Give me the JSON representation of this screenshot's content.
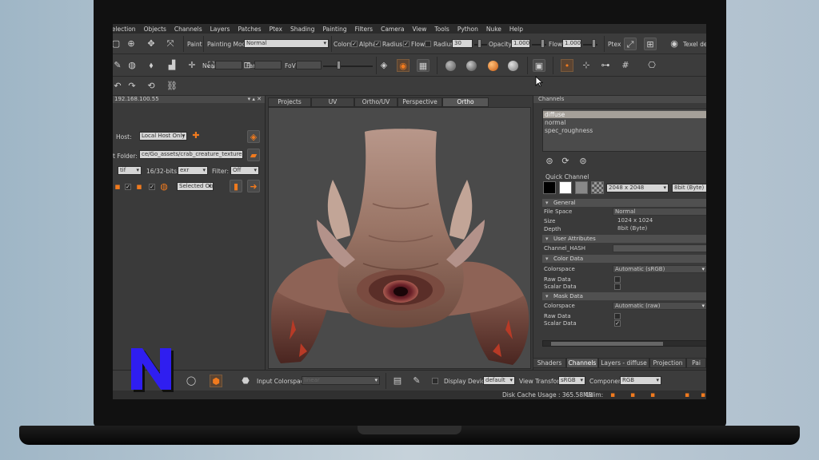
{
  "menu": [
    "Selection",
    "Objects",
    "Channels",
    "Layers",
    "Patches",
    "Ptex",
    "Shading",
    "Painting",
    "Filters",
    "Camera",
    "View",
    "Tools",
    "Python",
    "Nuke",
    "Help"
  ],
  "toolbar1": {
    "paint_label": "Paint",
    "painting_mode_label": "Painting Mode",
    "painting_mode_value": "Normal",
    "colors_label": "Colors",
    "alpha_label": "Alpha",
    "radius_check_label": "Radius",
    "flow_check_label": "Flow",
    "radius_label": "Radius",
    "radius_value": "30",
    "opacity_label": "Opacity",
    "opacity_value": "1.000",
    "flow_label": "Flow",
    "flow_value": "1.000",
    "ptex_label": "Ptex",
    "texel_label": "Texel de"
  },
  "toolbar2": {
    "near_label": "Near",
    "far_label": "Far",
    "fov_label": "FoV"
  },
  "left_panel": {
    "header_text": "192.168.100.55",
    "host_label": "Host:",
    "host_value": "Local Host Only",
    "folder_label": "t Folder:",
    "folder_value": "ce/Go_assets/crab_creature_textured",
    "format_value": "tif",
    "bits_label": "16/32-bits:",
    "bits_value": "exr",
    "filter_label": "Filter:",
    "filter_value": "Off",
    "objects_value": "Selected Obj"
  },
  "viewport_tabs": [
    "Projects",
    "UV",
    "Ortho/UV",
    "Perspective",
    "Ortho"
  ],
  "channels": {
    "title": "Channels",
    "items": [
      "diffuse",
      "normal",
      "spec_roughness"
    ],
    "quick_channel_label": "Quick Channel",
    "size_value": "2048 x 2048",
    "depth_value": "8bit (Byte)",
    "general_label": "General",
    "file_space_label": "File Space",
    "file_space_value": "Normal",
    "size_label": "Size",
    "size_info": "1024 x 1024",
    "depth_label": "Depth",
    "depth_info": "8bit (Byte)",
    "user_attr_label": "User Attributes",
    "channel_hash_label": "Channel_HASH",
    "color_data_label": "Color Data",
    "colorspace_label": "Colorspace",
    "colorspace_value": "Automatic (sRGB)",
    "raw_data_label": "Raw Data",
    "scalar_data_label": "Scalar Data",
    "mask_data_label": "Mask Data",
    "mask_colorspace_label": "Colorspace",
    "mask_colorspace_value": "Automatic (raw)",
    "mask_raw_label": "Raw Data",
    "mask_scalar_label": "Scalar Data"
  },
  "bottom_tabs": [
    "Shaders",
    "Channels",
    "Layers - diffuse",
    "Projection",
    "Pai"
  ],
  "bottom_bar": {
    "input_colorspace_label": "Input Colorspace",
    "input_colorspace_value": "linear",
    "display_device_label": "Display Device",
    "display_device_value": "default",
    "view_transform_label": "View Transform",
    "view_transform_value": "sRGB",
    "component_label": "Component",
    "component_value": "RGB"
  },
  "status": {
    "disk_cache": "Disk Cache Usage : 365.58MB",
    "udim_label": "Udim:"
  },
  "colors": {
    "accent": "#f07a1e",
    "panel_bg": "#3a3a3a",
    "viewport_bg": "#4a4a4a",
    "logo": "#2f1ef0"
  }
}
